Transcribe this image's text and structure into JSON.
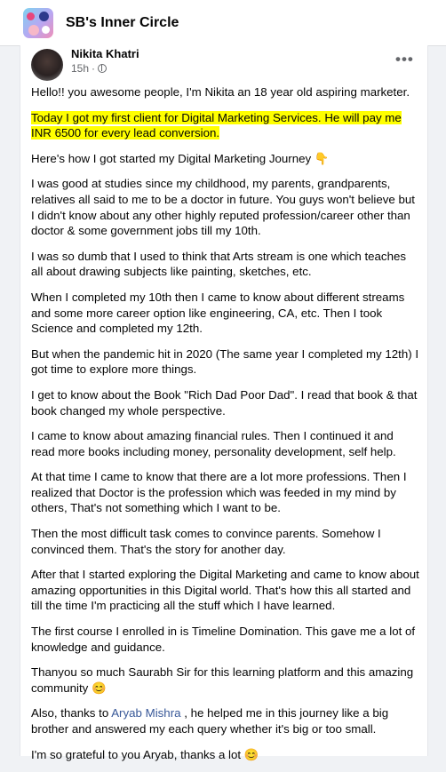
{
  "group": {
    "name": "SB's Inner Circle",
    "logo_icon": "group-avatar-icon"
  },
  "post": {
    "author": "Nikita Khatri",
    "time": "15h",
    "time_separator": "·",
    "privacy_icon": "globe-icon",
    "more_label": "•••",
    "paragraphs": [
      "Hello!! you awesome people, I'm Nikita an 18 year old aspiring marketer.",
      "Here's how I got started my Digital Marketing Journey 👇",
      "I was good at studies since my childhood, my parents, grandparents, relatives all said to me to be a doctor in future. You guys won't believe but I didn't know about any other highly reputed profession/career other than doctor & some government jobs till my 10th.",
      "I was so dumb that I used to think that Arts stream is one which teaches all about drawing subjects like painting, sketches, etc.",
      "When I completed my 10th then I came to know about different streams and some more career option like engineering, CA, etc. Then I took Science and completed my 12th.",
      "But when the pandemic hit in 2020 (The same year I completed my 12th) I got time to explore more things.",
      "I get to know about the Book \"Rich Dad Poor Dad\". I read that book & that book changed my whole perspective.",
      "I came to know about amazing financial rules. Then I continued it and read more books including money, personality development, self help.",
      "At that time I came to know that there are a lot more professions. Then I realized that Doctor is the profession which was feeded in my mind by others, That's not something which I want to be.",
      "Then the most difficult task comes to convince parents. Somehow I convinced them. That's the story for another day.",
      "After that I started exploring the Digital Marketing and came to know about amazing opportunities in this Digital world. That's how this all started and till the time I'm practicing all the stuff which I have learned.",
      "The first course I enrolled in is Timeline Domination. This gave me a lot of knowledge and guidance.",
      "Thanyou so much Saurabh Sir for this learning platform and this amazing community 😊",
      "I'm so grateful to you Aryab, thanks a lot 😊"
    ],
    "highlight": "Today I got my first client for Digital Marketing Services. He will pay me INR 6500 for every lead conversion.",
    "thanks_prefix": "Also, thanks to ",
    "mention": "Aryab Mishra",
    "thanks_suffix": " , he helped me in this journey like a big brother and answered my each query whether it's big or too small."
  },
  "colors": {
    "highlight": "#ffff00",
    "mention": "#385898",
    "secondary_text": "#65676b"
  }
}
